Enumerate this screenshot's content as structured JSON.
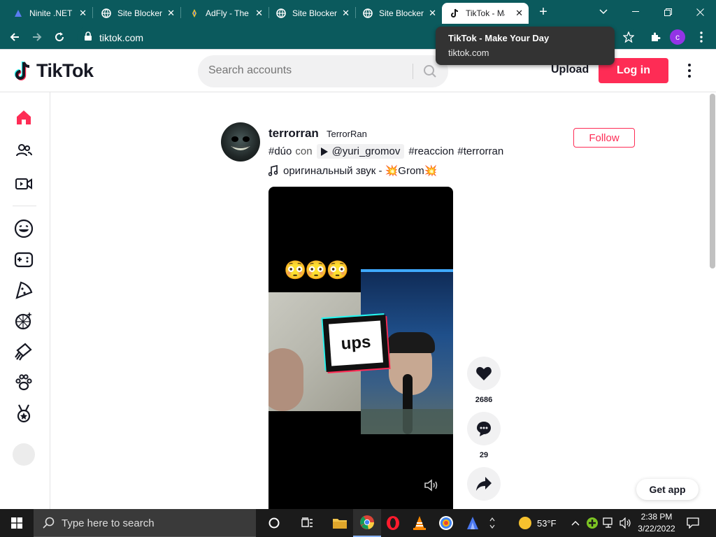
{
  "browser": {
    "tabs": [
      {
        "title": "Ninite .NET",
        "icon": "ninite-icon"
      },
      {
        "title": "Site Blocker",
        "icon": "globe-icon"
      },
      {
        "title": "AdFly - The",
        "icon": "adfly-icon"
      },
      {
        "title": "Site Blocker",
        "icon": "globe-icon"
      },
      {
        "title": "Site Blocker",
        "icon": "globe-icon"
      },
      {
        "title": "TikTok - Ma",
        "icon": "tiktok-icon",
        "active": true
      }
    ],
    "url": "tiktok.com",
    "tooltip": {
      "title": "TikTok - Make Your Day",
      "url": "tiktok.com"
    },
    "profile_initial": "c"
  },
  "header": {
    "logo": "TikTok",
    "search_placeholder": "Search accounts",
    "upload": "Upload",
    "login": "Log in"
  },
  "post": {
    "author_name": "terrorran",
    "author_nick": "TerrorRan",
    "follow": "Follow",
    "caption": {
      "tag1": "#dúo",
      "con": "con",
      "mention": "@yuri_gromov",
      "tag2": "#reaccion",
      "tag3": "#terrorran"
    },
    "music": "оригинальный звук - 💥Grom💥",
    "video": {
      "emojis": "😳😳😳",
      "sticker": "ups"
    },
    "likes": "2686",
    "comments": "29"
  },
  "get_app": "Get app",
  "taskbar": {
    "search_placeholder": "Type here to search",
    "weather": "53°F",
    "time": "2:38 PM",
    "date": "3/22/2022"
  },
  "colors": {
    "brand": "#fe2c55",
    "tabstrip": "#0b5a5d"
  }
}
